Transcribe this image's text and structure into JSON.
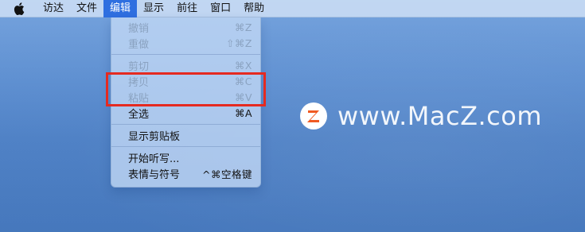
{
  "menubar": {
    "items": [
      {
        "label": "访达"
      },
      {
        "label": "文件"
      },
      {
        "label": "编辑",
        "active": true
      },
      {
        "label": "显示"
      },
      {
        "label": "前往"
      },
      {
        "label": "窗口"
      },
      {
        "label": "帮助"
      }
    ]
  },
  "edit_menu": {
    "undo": {
      "label": "撤销",
      "shortcut": "⌘Z"
    },
    "redo": {
      "label": "重做",
      "shortcut": "⇧⌘Z"
    },
    "cut": {
      "label": "剪切",
      "shortcut": "⌘X"
    },
    "copy": {
      "label": "拷贝",
      "shortcut": "⌘C"
    },
    "paste": {
      "label": "粘贴",
      "shortcut": "⌘V"
    },
    "select_all": {
      "label": "全选",
      "shortcut": "⌘A"
    },
    "show_clipboard": {
      "label": "显示剪贴板"
    },
    "start_dictation": {
      "label": "开始听写..."
    },
    "emoji_symbols": {
      "label": "表情与符号",
      "shortcut": "^⌘空格键"
    }
  },
  "watermark": {
    "text": "www.MacZ.com"
  },
  "colors": {
    "menu_highlight": "#2f6fe0",
    "red_box": "#e52a20",
    "logo_orange": "#f05a22",
    "disabled_text": "#8aa2c0"
  }
}
